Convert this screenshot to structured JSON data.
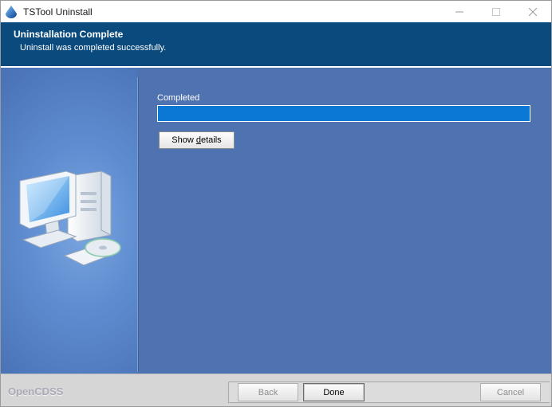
{
  "window": {
    "title": "TSTool Uninstall",
    "icons": {
      "app": "app-icon",
      "minimize": "minimize-icon",
      "maximize": "maximize-icon",
      "close": "close-icon"
    }
  },
  "header": {
    "title": "Uninstallation Complete",
    "subtitle": "Uninstall was completed successfully."
  },
  "status": {
    "label": "Completed",
    "progress_fraction": 1.0
  },
  "details_button": {
    "prefix": "Show ",
    "accel": "d",
    "suffix": "etails"
  },
  "footer": {
    "brand": "OpenCDSS",
    "back_label": "Back",
    "done_label": "Done",
    "cancel_label": "Cancel"
  },
  "colors": {
    "header_bg": "#0b4a7d",
    "panel_bg": "#4f72b0",
    "progress_fill": "#0a78d4"
  }
}
